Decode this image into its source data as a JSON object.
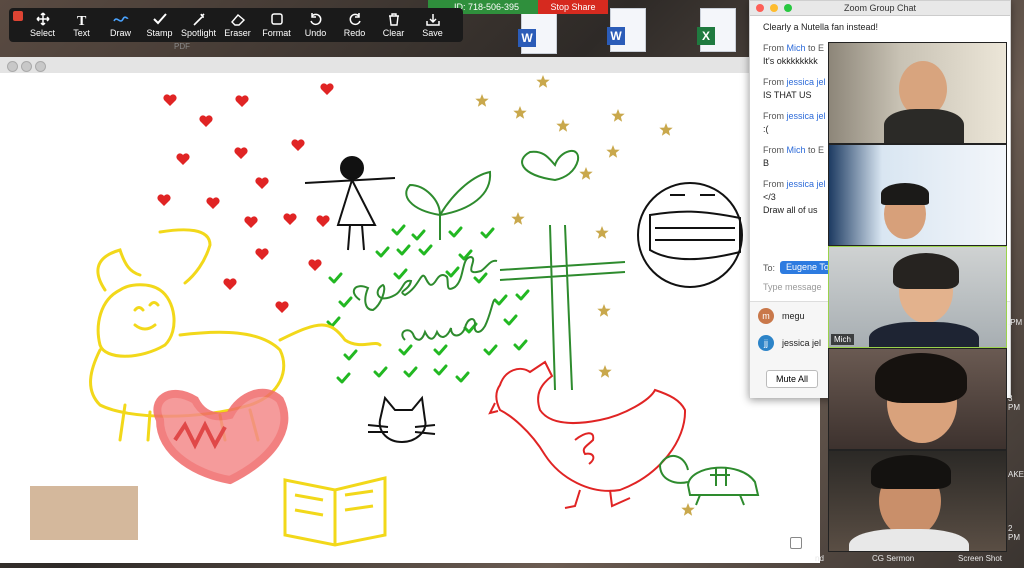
{
  "toolbar": {
    "tools": [
      {
        "label": "Select",
        "icon": "move-icon"
      },
      {
        "label": "Text",
        "icon": "text-icon"
      },
      {
        "label": "Draw",
        "icon": "draw-icon"
      },
      {
        "label": "Stamp",
        "icon": "checkmark-icon"
      },
      {
        "label": "Spotlight",
        "icon": "spotlight-icon"
      },
      {
        "label": "Eraser",
        "icon": "eraser-icon"
      },
      {
        "label": "Format",
        "icon": "format-icon"
      },
      {
        "label": "Undo",
        "icon": "undo-icon"
      },
      {
        "label": "Redo",
        "icon": "redo-icon"
      },
      {
        "label": "Clear",
        "icon": "trash-icon"
      },
      {
        "label": "Save",
        "icon": "save-icon"
      }
    ]
  },
  "meeting": {
    "id_text": "ID: 718-506-395",
    "stop_share": "Stop Share"
  },
  "desktop": {
    "pdf_label": "PDF",
    "bottom_labels": [
      "nd",
      "CG Sermon",
      "Screen Shot"
    ],
    "right_labels": [
      ".PM",
      "3 PM",
      "AKE",
      "2 PM"
    ]
  },
  "chat": {
    "title": "Zoom Group Chat",
    "first_line": "Clearly a Nutella fan instead!",
    "messages": [
      {
        "from_prefix": "From",
        "sender": "Mich",
        "to": "to E",
        "text": [
          "It's okkkkkkkk"
        ]
      },
      {
        "from_prefix": "From",
        "sender": "jessica jel",
        "to": "",
        "text": [
          "IS THAT US"
        ]
      },
      {
        "from_prefix": "From",
        "sender": "jessica jel",
        "to": "",
        "text": [
          ":("
        ]
      },
      {
        "from_prefix": "From",
        "sender": "Mich",
        "to": "to E",
        "text": [
          "B"
        ]
      },
      {
        "from_prefix": "From",
        "sender": "jessica jel",
        "to": "",
        "text": [
          "</3",
          "Draw all of us"
        ]
      }
    ],
    "to_label": "To:",
    "to_value": "Eugene To",
    "input_placeholder": "Type message",
    "participants": [
      {
        "initial": "m",
        "name": "megu",
        "color": "#c9784a"
      },
      {
        "initial": "jj",
        "name": "jessica jel",
        "color": "#2d84c8"
      }
    ],
    "mute_all": "Mute All"
  },
  "videos": [
    {
      "name": ""
    },
    {
      "name": ""
    },
    {
      "name": "Mich"
    },
    {
      "name": ""
    },
    {
      "name": ""
    }
  ],
  "whiteboard": {
    "ink_colors": {
      "red": "#e02424",
      "gold": "#c9a84c",
      "green": "#2e8b2e",
      "check": "#22b822",
      "yellow": "#f2d81a",
      "black": "#111111",
      "pink": "#f06b6b",
      "tan": "#d4b89c"
    },
    "drawn_text": [
      "george",
      "orwell"
    ]
  }
}
